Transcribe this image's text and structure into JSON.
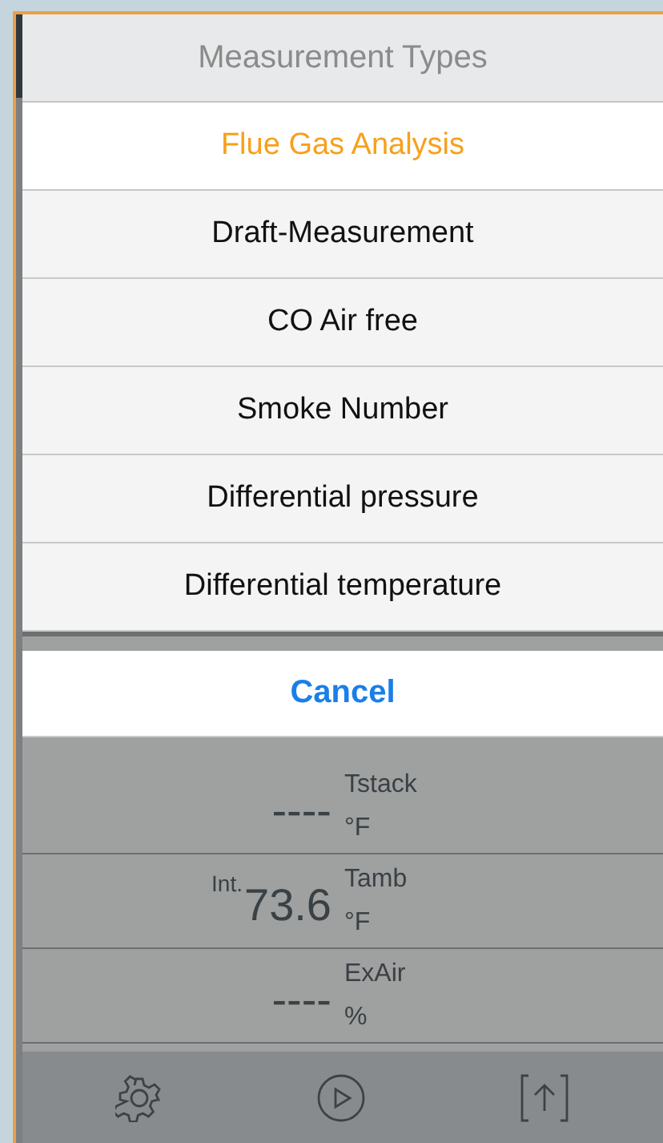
{
  "sheet": {
    "title": "Measurement Types",
    "options": [
      {
        "label": "Flue Gas Analysis",
        "selected": true
      },
      {
        "label": "Draft-Measurement",
        "selected": false
      },
      {
        "label": "CO Air free",
        "selected": false
      },
      {
        "label": "Smoke Number",
        "selected": false
      },
      {
        "label": "Differential pressure",
        "selected": false
      },
      {
        "label": "Differential temperature",
        "selected": false
      }
    ],
    "cancel": "Cancel"
  },
  "readings": [
    {
      "value": "----",
      "name": "Tstack",
      "unit": "°F"
    },
    {
      "prefix": "Int.",
      "value": "73.6",
      "name": "Tamb",
      "unit": "°F"
    },
    {
      "value": "----",
      "name": "ExAir",
      "unit": "%"
    }
  ],
  "toolbar": [
    {
      "kind": "settings"
    },
    {
      "kind": "play"
    },
    {
      "kind": "upload"
    }
  ]
}
